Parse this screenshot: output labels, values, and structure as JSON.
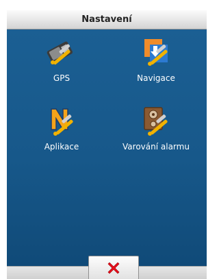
{
  "window": {
    "title": "Nastavení"
  },
  "tiles": [
    {
      "label": "GPS",
      "icon": "gps-settings-icon"
    },
    {
      "label": "Navigace",
      "icon": "navigation-settings-icon"
    },
    {
      "label": "Aplikace",
      "icon": "application-settings-icon"
    },
    {
      "label": "Varování alarmu",
      "icon": "alarm-warning-settings-icon"
    }
  ],
  "bottombar": {
    "close_icon": "close-icon",
    "close_color": "#e8101c"
  },
  "colors": {
    "content_bg": "#17588a",
    "tool_handle": "#f0b000"
  }
}
